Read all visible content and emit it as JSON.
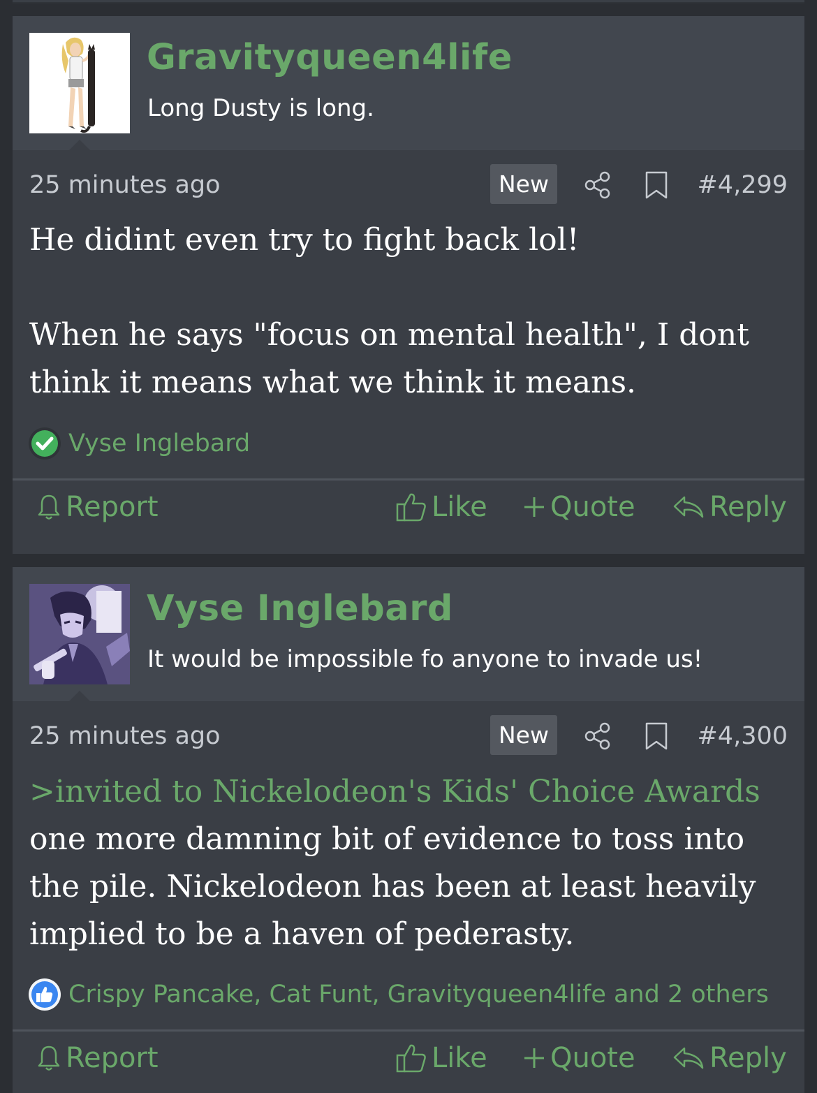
{
  "colors": {
    "accent": "#6aa86a",
    "page_bg": "#2b2e33",
    "post_bg": "#3a3e45",
    "header_bg": "#42474f",
    "badge_bg": "#54585f"
  },
  "posts": [
    {
      "username": "Gravityqueen4life",
      "user_title": "Long Dusty is long.",
      "avatar_icon": "girl-holding-long-cat-avatar",
      "timestamp": "25 minutes ago",
      "badge": "New",
      "post_number": "#4,299",
      "body_lines": [
        "He didint even try to fight back lol!",
        "When he says \"focus on mental health\", I dont think it means what we think it means."
      ],
      "reaction_icon": "checkmark-icon",
      "reactions_text": "Vyse Inglebard",
      "actions": {
        "report": "Report",
        "like": "Like",
        "quote": "Quote",
        "reply": "Reply"
      }
    },
    {
      "username": "Vyse Inglebard",
      "user_title": "It would be impossible fo anyone to invade us!",
      "avatar_icon": "anime-swordsman-avatar",
      "timestamp": "25 minutes ago",
      "badge": "New",
      "post_number": "#4,300",
      "quote_line": ">invited to Nickelodeon's Kids' Choice Awards",
      "body_lines": [
        "one more damning bit of evidence to toss into the pile. Nickelodeon has been at least heavily implied to be a haven of pederasty."
      ],
      "reaction_icon": "thumbs-up-icon",
      "reactions_text": "Crispy Pancake, Cat Funt, Gravityqueen4life and 2 others",
      "actions": {
        "report": "Report",
        "like": "Like",
        "quote": "Quote",
        "reply": "Reply"
      }
    }
  ]
}
